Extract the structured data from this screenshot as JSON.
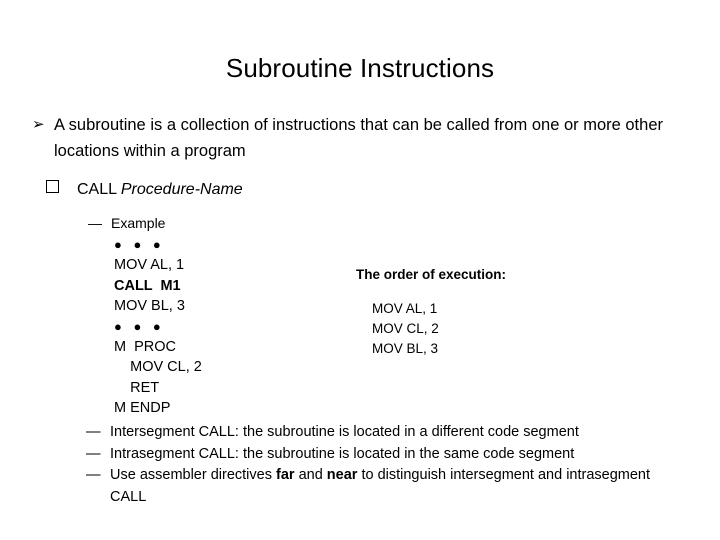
{
  "slide": {
    "title": "Subroutine Instructions",
    "bullets": {
      "arrow_glyph": "➢",
      "square_glyph": "",
      "dash_glyph": "—",
      "dots_glyph": "● ● ●"
    },
    "level1": {
      "text": "A subroutine is a collection of instructions that can be called from one or more other locations within a program"
    },
    "level2": {
      "keyword": "CALL ",
      "operand": "Procedure-Name"
    },
    "level3": {
      "label": "Example"
    },
    "code": [
      {
        "text": "● ● ●",
        "bold": false,
        "dots": true
      },
      {
        "text": "MOV AL, 1",
        "bold": false,
        "dots": false
      },
      {
        "text": "CALL  M1",
        "bold": true,
        "dots": false
      },
      {
        "text": "MOV BL, 3",
        "bold": false,
        "dots": false
      },
      {
        "text": "● ● ●",
        "bold": false,
        "dots": true
      },
      {
        "text": "M  PROC",
        "bold": false,
        "dots": false
      },
      {
        "text": "    MOV CL, 2",
        "bold": false,
        "dots": false
      },
      {
        "text": "    RET",
        "bold": false,
        "dots": false
      },
      {
        "text": "M ENDP",
        "bold": false,
        "dots": false
      }
    ],
    "execution": {
      "heading": "The order of execution:",
      "items": [
        "MOV AL, 1",
        "MOV CL, 2",
        "MOV BL, 3"
      ]
    },
    "notes": [
      {
        "pre": "Intersegment CALL:  the subroutine is located in a different code segment",
        "bold1": "",
        "mid": "",
        "bold2": "",
        "post": ""
      },
      {
        "pre": "Intrasegment CALL:  the subroutine is located in the same code segment",
        "bold1": "",
        "mid": "",
        "bold2": "",
        "post": ""
      },
      {
        "pre": "Use assembler directives ",
        "bold1": "far",
        "mid": " and ",
        "bold2": "near",
        "post": " to distinguish intersegment and intrasegment CALL"
      }
    ]
  },
  "colors": {
    "background": "#ffffff",
    "text": "#000000"
  }
}
